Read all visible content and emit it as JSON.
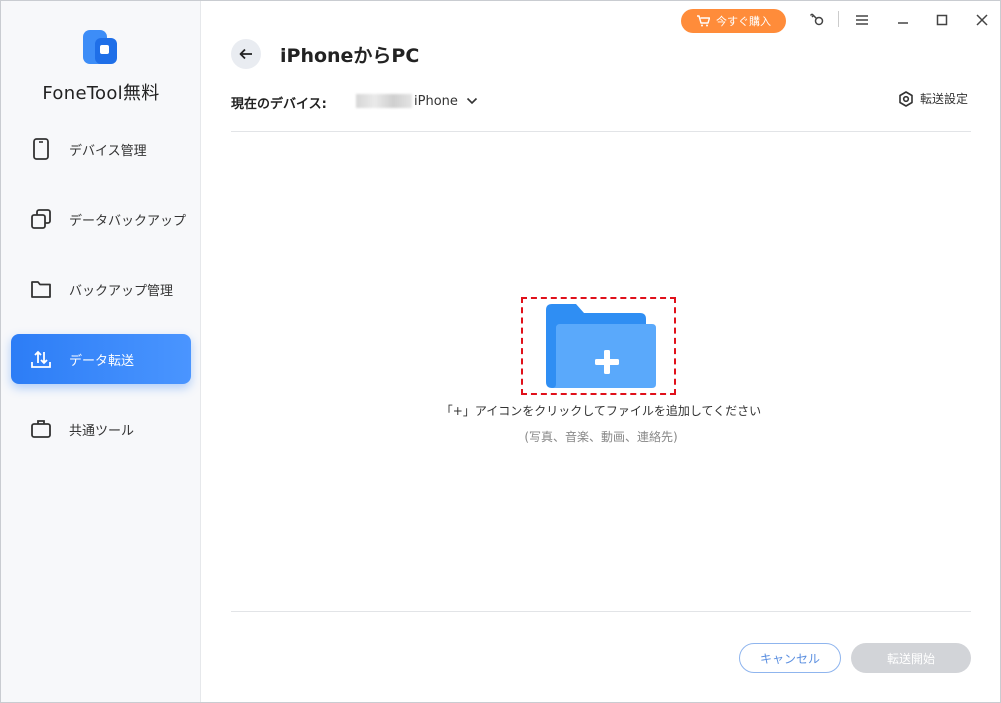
{
  "app": {
    "brand": "FoneTool無料"
  },
  "titlebar": {
    "buy_label": "今すぐ購入"
  },
  "sidebar": {
    "items": [
      {
        "label": "デバイス管理",
        "icon": "phone-icon",
        "active": false
      },
      {
        "label": "データバックアップ",
        "icon": "copy-icon",
        "active": false
      },
      {
        "label": "バックアップ管理",
        "icon": "folder-icon",
        "active": false
      },
      {
        "label": "データ転送",
        "icon": "transfer-icon",
        "active": true
      },
      {
        "label": "共通ツール",
        "icon": "briefcase-icon",
        "active": false
      }
    ]
  },
  "header": {
    "title": "iPhoneからPC",
    "device_label": "現在のデバイス:",
    "device_name": "iPhone",
    "settings_label": "転送設定"
  },
  "main": {
    "hint": "「+」アイコンをクリックしてファイルを追加してください",
    "sub_hint": "(写真、音楽、動画、連絡先)"
  },
  "footer": {
    "cancel_label": "キャンセル",
    "start_label": "転送開始"
  },
  "colors": {
    "accent": "#2c7df6",
    "buy": "#ff8c3a",
    "highlight": "#e0101a",
    "folder_back": "#2f8ef3",
    "folder_front": "#5aa9fb"
  }
}
